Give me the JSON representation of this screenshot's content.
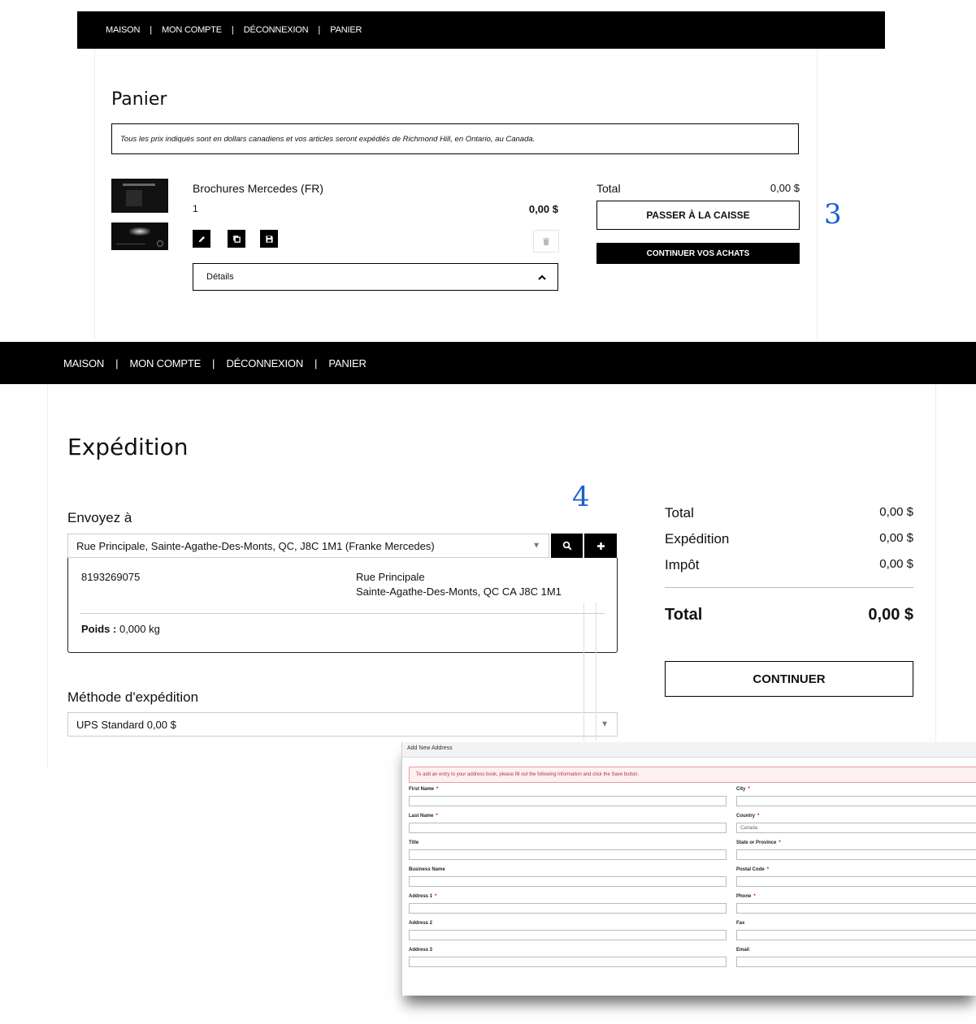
{
  "nav": {
    "items": [
      "MAISON",
      "MON COMPTE",
      "DÉCONNEXION",
      "PANIER"
    ]
  },
  "cart": {
    "title": "Panier",
    "notice": "Tous les prix indiqués sont en dollars canadiens et vos articles seront expédiés de Richmond Hill, en Ontario, au Canada.",
    "item": {
      "name": "Brochures Mercedes (FR)",
      "quantity": "1",
      "price": "0,00 $",
      "details_label": "Détails"
    },
    "total_label": "Total",
    "total_value": "0,00 $",
    "checkout_label": "PASSER À LA CAISSE",
    "continue_label": "CONTINUER VOS ACHATS",
    "step": "3"
  },
  "shipping": {
    "title": "Expédition",
    "ship_to_label": "Envoyez à",
    "address_selected": "Rue Principale, Sainte-Agathe-Des-Monts, QC, J8C 1M1 (Franke Mercedes)",
    "phone": "8193269075",
    "address_line1": "Rue Principale",
    "address_line2": "Sainte-Agathe-Des-Monts, QC CA J8C 1M1",
    "weight_label": "Poids :",
    "weight_value": "0,000 kg",
    "method_label": "Méthode d'expédition",
    "method_value": "UPS Standard 0,00 $",
    "step": "4",
    "summary": {
      "total_label": "Total",
      "total_value": "0,00 $",
      "shipping_label": "Expédition",
      "shipping_value": "0,00 $",
      "tax_label": "Impôt",
      "tax_value": "0,00 $",
      "grand_label": "Total",
      "grand_value": "0,00 $",
      "continue_label": "CONTINUER"
    }
  },
  "modal": {
    "title": "Add New Address",
    "notice": "To add an entry to your address book, please fill out the following information and click the Save button.",
    "left_fields": [
      {
        "label": "First Name",
        "required": "*"
      },
      {
        "label": "Last Name",
        "required": "*"
      },
      {
        "label": "Title",
        "required": ""
      },
      {
        "label": "Business Name",
        "required": ""
      },
      {
        "label": "Address 1",
        "required": "*"
      },
      {
        "label": "Address 2",
        "required": ""
      },
      {
        "label": "Address 3",
        "required": ""
      }
    ],
    "right_fields": [
      {
        "label": "City",
        "required": "*",
        "value": ""
      },
      {
        "label": "Country",
        "required": "*",
        "value": "Canada"
      },
      {
        "label": "State or Province",
        "required": "*",
        "value": ""
      },
      {
        "label": "Postal Code",
        "required": "*",
        "value": ""
      },
      {
        "label": "Phone",
        "required": "*",
        "value": ""
      },
      {
        "label": "Fax",
        "required": "",
        "value": ""
      },
      {
        "label": "Email",
        "required": "",
        "value": ""
      }
    ]
  }
}
